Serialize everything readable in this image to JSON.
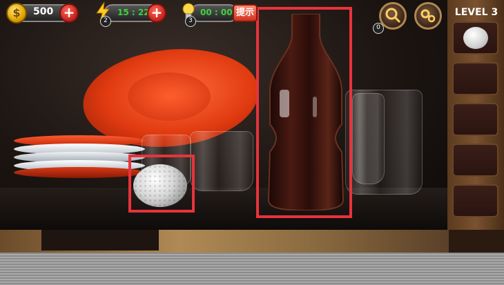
{
  "hud": {
    "coins": {
      "value": "500"
    },
    "energy": {
      "timer": "15 : 22",
      "count": "2"
    },
    "hints": {
      "timer": "00 : 00",
      "count": "3",
      "hint_button_label": "提示"
    },
    "magnifier_count": "0"
  },
  "level": {
    "label": "LEVEL 3"
  },
  "inventory": {
    "slots": [
      {
        "item": "golf-ball"
      },
      {
        "item": ""
      },
      {
        "item": ""
      },
      {
        "item": ""
      },
      {
        "item": ""
      }
    ]
  },
  "highlights": [
    {
      "target": "golf-ball"
    },
    {
      "target": "bottle"
    }
  ],
  "colors": {
    "highlight": "#e8333b",
    "timer_text": "#3fd13f",
    "plate_red": "#e03a10"
  }
}
